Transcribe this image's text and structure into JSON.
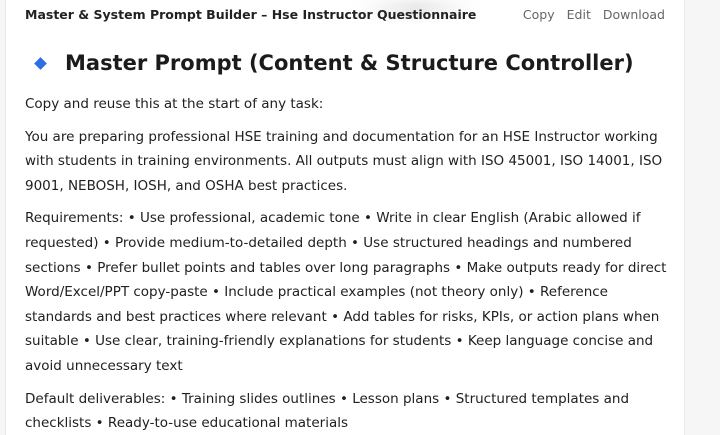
{
  "header": {
    "title": "Master & System Prompt Builder – Hse Instructor Questionnaire",
    "actions": {
      "copy": "Copy",
      "edit": "Edit",
      "download": "Download"
    }
  },
  "section": {
    "heading": "Master Prompt (Content & Structure Controller)",
    "paragraphs": [
      "Copy and reuse this at the start of any task:",
      "You are preparing professional HSE training and documentation for an HSE Instructor working with students in training environments. All outputs must align with ISO 45001, ISO 14001, ISO 9001, NEBOSH, IOSH, and OSHA best practices.",
      "Requirements: • Use professional, academic tone • Write in clear English (Arabic allowed if requested) • Provide medium-to-detailed depth • Use structured headings and numbered sections • Prefer bullet points and tables over long paragraphs • Make outputs ready for direct Word/Excel/PPT copy-paste • Include practical examples (not theory only) • Reference standards and best practices where relevant • Add tables for risks, KPIs, or action plans when suitable • Use clear, training-friendly explanations for students • Keep language concise and avoid unnecessary text",
      "Default deliverables: • Training slides outlines • Lesson plans • Structured templates and checklists • Ready-to-use educational materials"
    ]
  },
  "colors": {
    "accent_icon": "#2f6fe4",
    "action_text": "#666666",
    "body_text": "#202020"
  },
  "icons": {
    "heading_icon": "blue-diamond-icon"
  }
}
